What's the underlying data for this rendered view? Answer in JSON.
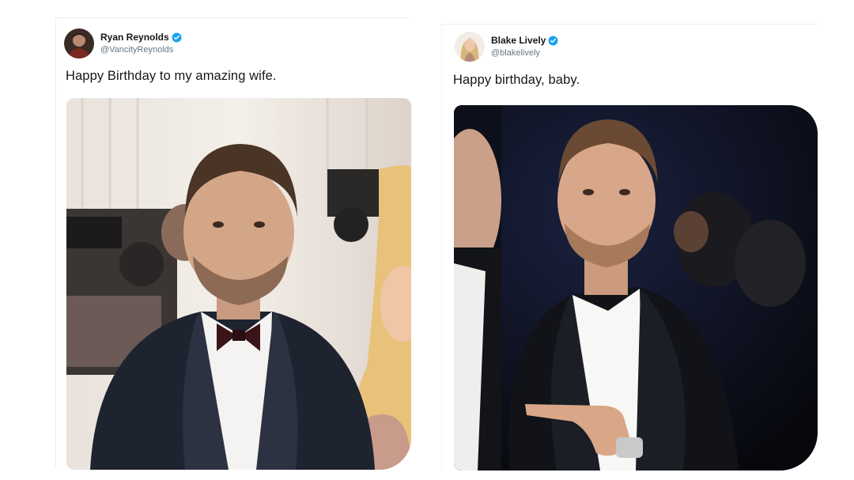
{
  "tweets": [
    {
      "author": {
        "name": "Ryan Reynolds",
        "handle": "@VancityReynolds",
        "verified": true
      },
      "text": "Happy Birthday to my amazing wife.",
      "avatar_icon": "avatar-ryan-reynolds",
      "photo_icon": "photo-man-in-velvet-tuxedo-bowtie",
      "colors": {
        "verified": "#1da1f2",
        "handle": "#657786"
      }
    },
    {
      "author": {
        "name": "Blake Lively",
        "handle": "@blakelively",
        "verified": true
      },
      "text": "Happy birthday, baby.",
      "avatar_icon": "avatar-blake-lively",
      "photo_icon": "photo-man-in-black-tuxedo-pointing",
      "colors": {
        "verified": "#1da1f2",
        "handle": "#657786"
      }
    }
  ]
}
